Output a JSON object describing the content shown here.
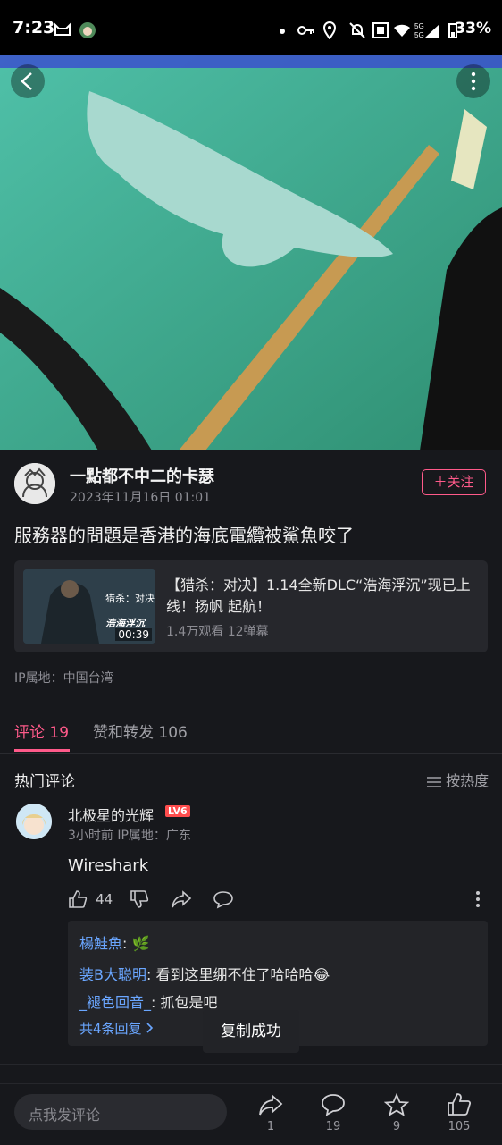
{
  "status_bar": {
    "time": "7:23",
    "battery": "33%"
  },
  "post": {
    "author_name": "一點都不中二的卡瑟",
    "timestamp": "2023年11月16日 01:01",
    "follow_label": "关注",
    "title": "服務器的問題是香港的海底電纜被鯊魚咬了",
    "ip_location": "IP属地：中国台湾"
  },
  "related_video": {
    "thumbnail_overlay_line1": "猎杀：对决",
    "thumbnail_overlay_line2": "浩海浮沉",
    "duration": "00:39",
    "title": "【猎杀：对决】1.14全新DLC“浩海浮沉”现已上线！扬帆 起航！",
    "stats": "1.4万观看 12弹幕"
  },
  "tabs": [
    {
      "label": "评论 19",
      "active": true
    },
    {
      "label": "赞和转发 106",
      "active": false
    }
  ],
  "comments_section": {
    "header": "热门评论",
    "sort_label": "按热度"
  },
  "comment": {
    "user": "北极星的光辉",
    "level": "LV6",
    "meta": "3小时前  IP属地：广东",
    "text": "Wireshark",
    "likes": "44",
    "replies": [
      {
        "user": "楊鮭魚",
        "text": "🌿"
      },
      {
        "user": "装B大聪明",
        "text": "看到这里绷不住了哈哈哈😂"
      },
      {
        "user": "_褪色回音_",
        "text": "抓包是吧"
      }
    ],
    "view_all": "共4条回复"
  },
  "toast": "复制成功",
  "bottom_bar": {
    "input_placeholder": "点我发评论",
    "share_count": "1",
    "comment_count": "19",
    "favorite_count": "9",
    "like_count": "105"
  },
  "colors": {
    "accent": "#ff5a8a",
    "background": "#17181c",
    "link": "#6aa6ff"
  }
}
